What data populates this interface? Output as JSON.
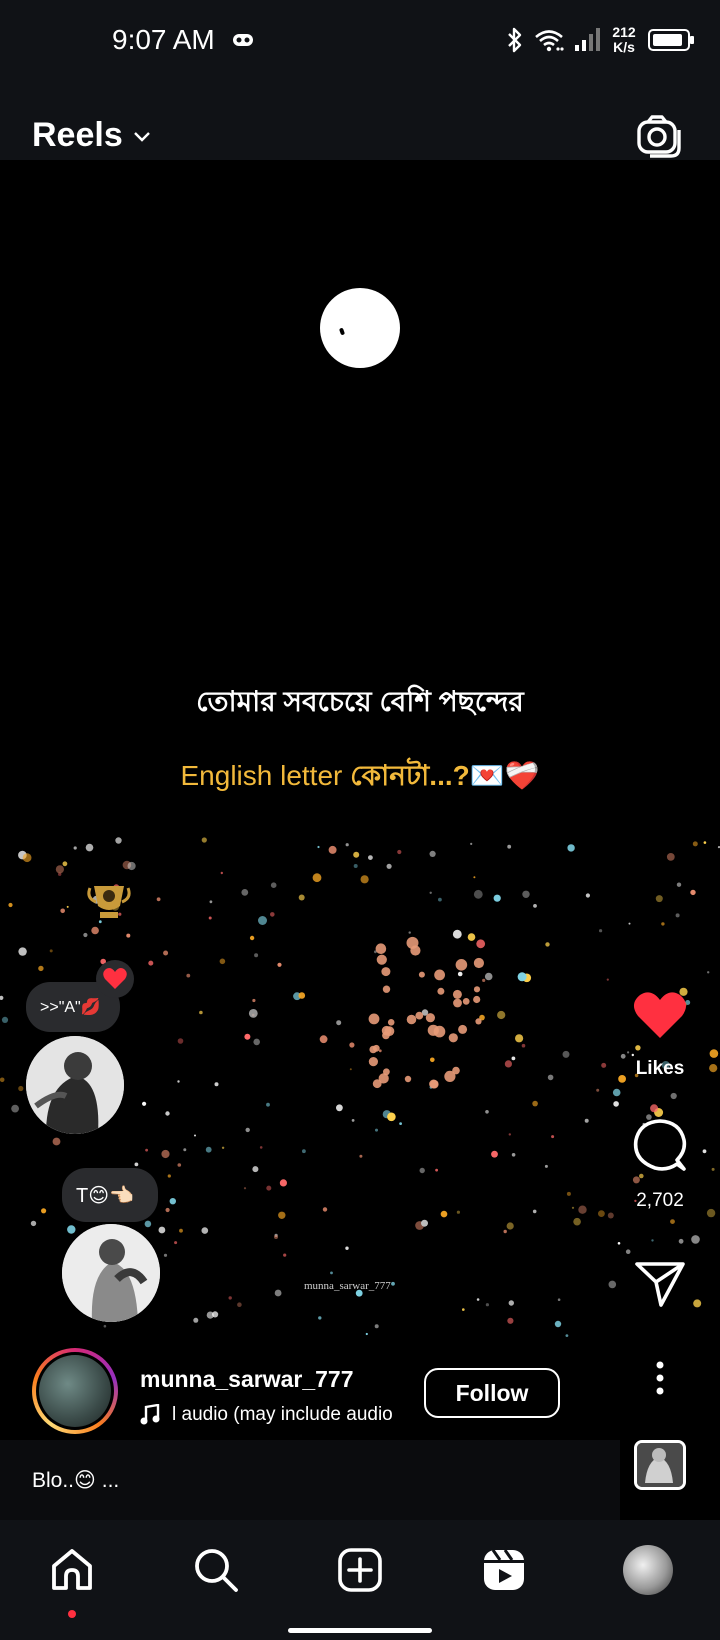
{
  "status_bar": {
    "time": "9:07 AM",
    "net_speed_value": "212",
    "net_speed_unit": "K/s",
    "battery_level": 0.9,
    "icons": [
      "game-controller-icon",
      "bluetooth-icon",
      "wifi-icon",
      "signal-icon",
      "battery-icon"
    ]
  },
  "header": {
    "title": "Reels",
    "dropdown_icon": "chevron-down-icon",
    "camera_icon": "camera-icon"
  },
  "video": {
    "caption_line1": "তোমার সবচেয়ে বেশি পছন্দের",
    "caption_line2_en": "English letter ",
    "caption_line2_bn": "কোনটা...?",
    "caption_line2_emoji": "💌❤️‍🩹",
    "watermark": "munna_sarwar_777"
  },
  "notes": {
    "note1": ">>\"A\"💋",
    "note2": "T😊👈🏻"
  },
  "actions": {
    "like_label": "Likes",
    "comment_count": "2,702"
  },
  "creator": {
    "username": "munna_sarwar_777",
    "audio": "l audio (may include audio",
    "follow_label": "Follow"
  },
  "caption": {
    "text": "Blo..😊 ..."
  },
  "nav": [
    "home-icon",
    "search-icon",
    "create-icon",
    "reels-icon",
    "profile-icon"
  ],
  "colors": {
    "accent_red": "#ff3040",
    "caption_yellow": "#f2b93b",
    "bar_bg": "#101216"
  }
}
